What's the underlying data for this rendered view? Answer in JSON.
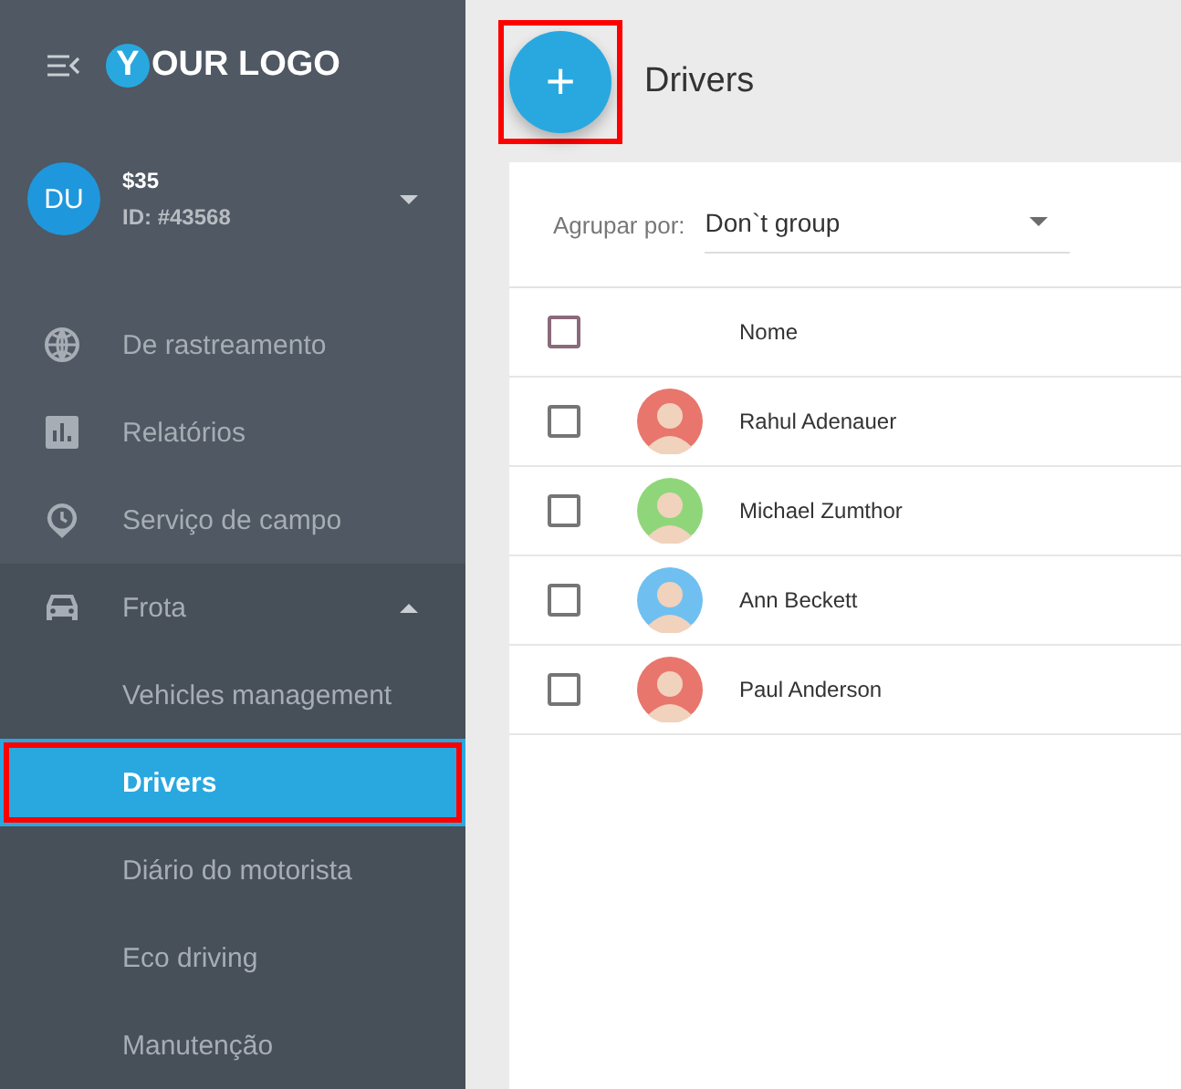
{
  "logo": {
    "letter": "Y",
    "text": "OUR LOGO"
  },
  "user": {
    "initials": "DU",
    "balance": "$35",
    "id": "ID: #43568",
    "expanded": false
  },
  "sidebar": {
    "items": [
      {
        "label": "De rastreamento",
        "kind": "globe",
        "selected": false
      },
      {
        "label": "Relatórios",
        "kind": "chart",
        "selected": false
      },
      {
        "label": "Serviço de campo",
        "kind": "clock",
        "selected": false
      },
      {
        "label": "Frota",
        "kind": "car",
        "selected": false,
        "expanded": true,
        "children": [
          {
            "label": "Vehicles management",
            "selected": false,
            "highlighted": false
          },
          {
            "label": "Drivers",
            "selected": true,
            "highlighted": true
          },
          {
            "label": "Diário do motorista",
            "selected": false,
            "highlighted": false
          },
          {
            "label": "Eco driving",
            "selected": false,
            "highlighted": false
          },
          {
            "label": "Manutenção",
            "selected": false,
            "highlighted": false
          }
        ]
      }
    ]
  },
  "header": {
    "title": "Drivers",
    "add_button": {
      "label": "+",
      "highlighted": true
    }
  },
  "filter": {
    "label": "Agrupar por:",
    "value": "Don`t group"
  },
  "table": {
    "columns": [
      "Nome"
    ],
    "select_all": {
      "checked": false
    },
    "rows": [
      {
        "name": "Rahul Adenauer",
        "checked": false,
        "color": "#e8766d"
      },
      {
        "name": "Michael Zumthor",
        "checked": false,
        "color": "#8fd67a"
      },
      {
        "name": "Ann Beckett",
        "checked": false,
        "color": "#6fc0f0"
      },
      {
        "name": "Paul Anderson",
        "checked": false,
        "color": "#e8766d"
      }
    ]
  }
}
